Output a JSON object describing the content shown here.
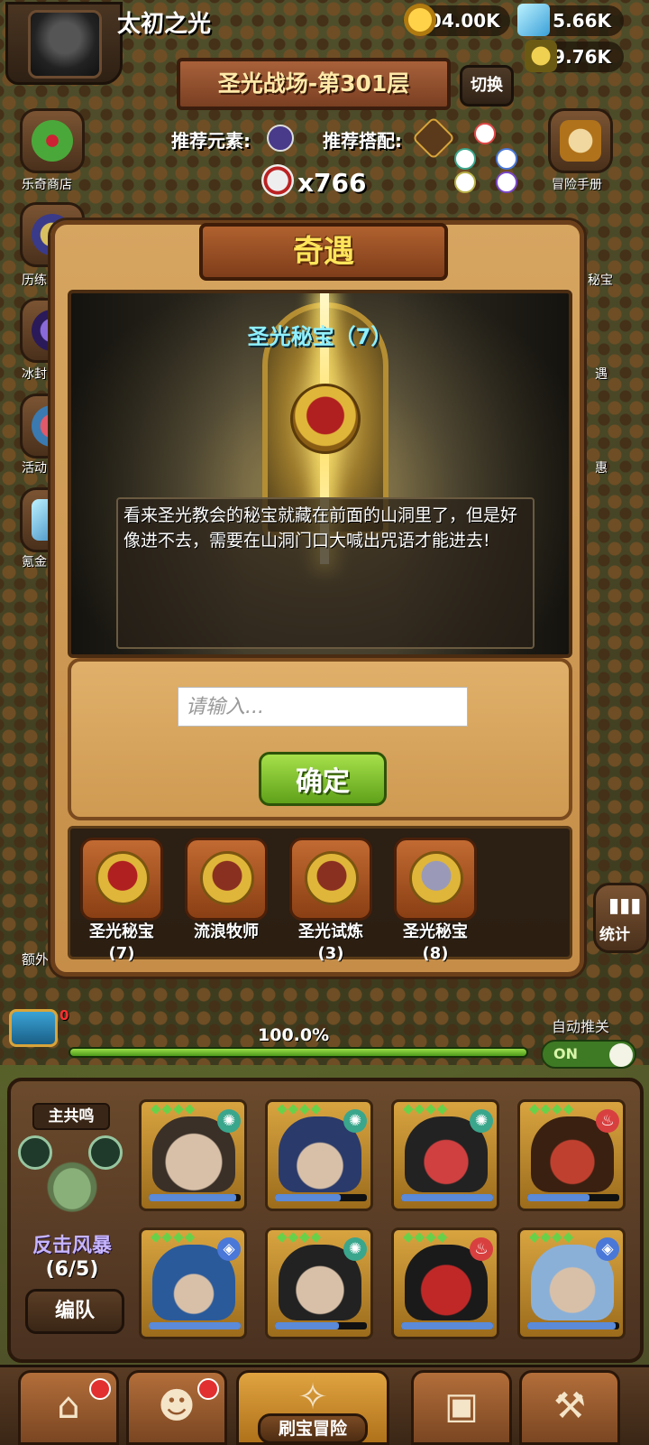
{
  "player": {
    "name": "太初之光"
  },
  "resources": {
    "gold": "104.00K",
    "gems": "5.66K",
    "potion": "69.76K"
  },
  "stage": {
    "title": "圣光战场-第301层",
    "switch_label": "切换"
  },
  "recommend": {
    "element_label": "推荐元素:",
    "combo_label": "推荐搭配:"
  },
  "kill_count": "x766",
  "side_left": [
    "乐奇商店",
    "历练",
    "冰封",
    "活动",
    "氪金"
  ],
  "side_right": [
    "冒险手册",
    "秘宝",
    "遇",
    "惠"
  ],
  "side_right_bottom": "统计",
  "side_left_bottom": "额外",
  "modal": {
    "title": "奇遇",
    "scene_title": "圣光秘宝（7）",
    "story": "看来圣光教会的秘宝就藏在前面的山洞里了，但是好像进不去，需要在山洞门口大喊出咒语才能进去!",
    "input_placeholder": "请输入...",
    "confirm_label": "确定",
    "history": [
      {
        "label": "圣光秘宝",
        "sub": "(7)",
        "icon": "demon-medal-icon"
      },
      {
        "label": "流浪牧师",
        "sub": "",
        "icon": "book-medal-icon"
      },
      {
        "label": "圣光试炼",
        "sub": "(3)",
        "icon": "book-medal-icon"
      },
      {
        "label": "圣光秘宝",
        "sub": "(8)",
        "icon": "helmet-medal-icon"
      }
    ]
  },
  "progress": {
    "text": "100.0%",
    "value": 1.0,
    "chest_badge": "0"
  },
  "auto_push": {
    "label": "自动推关",
    "state": "ON"
  },
  "team": {
    "resonance_label": "主共鸣",
    "skill_name": "反击风暴",
    "skill_count": "(6/5)",
    "formation_label": "编队"
  },
  "nav": {
    "active_label": "刷宝冒险"
  },
  "colors": {
    "accent": "#ffe45a",
    "scene_title": "#8ff0ff",
    "confirm": "#7cc12e",
    "skill": "#c7b5ff"
  }
}
